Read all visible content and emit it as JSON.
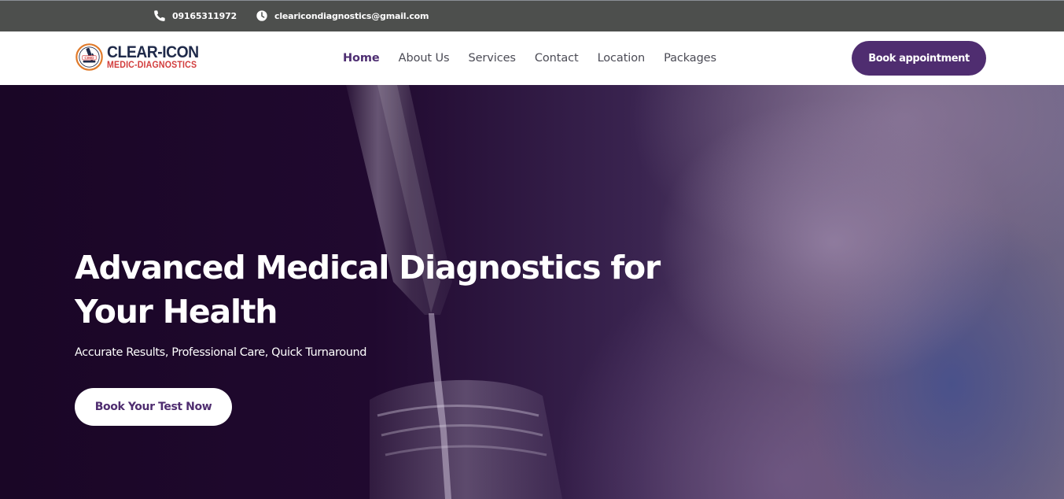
{
  "topbar": {
    "phone": "09165311972",
    "email": "clearicondiagnostics@gmail.com"
  },
  "brand": {
    "title": "CLEAR-ICON",
    "subtitle": "MEDIC-DIAGNOSTICS",
    "badge_text": "CIMD"
  },
  "nav": {
    "items": [
      {
        "label": "Home",
        "active": true
      },
      {
        "label": "About Us"
      },
      {
        "label": "Services"
      },
      {
        "label": "Contact"
      },
      {
        "label": "Location"
      },
      {
        "label": "Packages"
      }
    ],
    "cta_label": "Book appointment"
  },
  "hero": {
    "title": "Advanced Medical Diagnostics for Your Health",
    "subtitle": "Accurate Results, Professional Care, Quick Turnaround",
    "cta_label": "Book Your Test Now"
  },
  "colors": {
    "topbar_bg": "#4d4f4d",
    "brand_purple": "#4f2d70",
    "brand_navy": "#1f2a4a",
    "brand_red": "#d23c3c",
    "hero_dark": "#1c0a2a"
  },
  "icons": {
    "phone": "phone-icon",
    "clock": "clock-icon",
    "logo": "microscope-logo-icon"
  }
}
